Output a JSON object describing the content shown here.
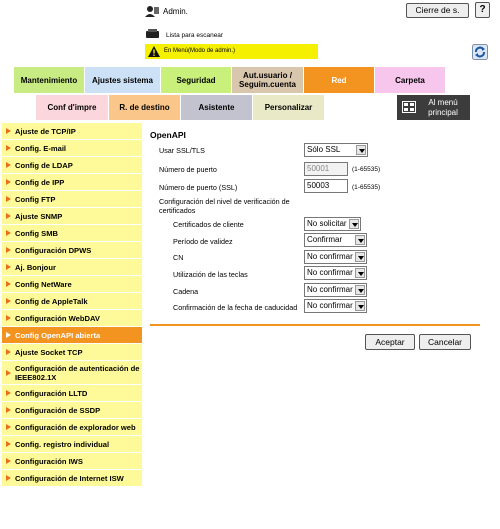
{
  "header": {
    "user_label": "Admin.",
    "logout_label": "Cierre de s.",
    "help_label": "?",
    "scan_list_label": "Lista para escanear",
    "mode_label": "En Menú(Modo de admin.)"
  },
  "tabs_top": [
    {
      "label": "Mantenimiento",
      "color": "#c9eb84"
    },
    {
      "label": "Ajustes sistema",
      "color": "#cce1f5"
    },
    {
      "label": "Seguridad",
      "color": "#c8f07a"
    },
    {
      "label": "Aut.usuario / Seguim.cuenta",
      "color": "#d9c7ad"
    },
    {
      "label": "Red",
      "color": "#f39320"
    },
    {
      "label": "Carpeta",
      "color": "#f7c6ec"
    }
  ],
  "tabs_bottom": [
    {
      "label": "Conf d'impre",
      "color": "#fbd6dd"
    },
    {
      "label": "R. de destino",
      "color": "#fbc68a"
    },
    {
      "label": "Asistente",
      "color": "#c3c3cf"
    },
    {
      "label": "Personalizar",
      "color": "#e9e9c7"
    }
  ],
  "menu_button": {
    "label": "Al menú principal"
  },
  "sidebar": {
    "items": [
      {
        "label": "Ajuste de TCP/IP"
      },
      {
        "label": "Config. E-mail"
      },
      {
        "label": "Config de LDAP"
      },
      {
        "label": "Config de IPP"
      },
      {
        "label": "Config FTP"
      },
      {
        "label": "Ajuste SNMP"
      },
      {
        "label": "Config SMB"
      },
      {
        "label": "Configuración DPWS"
      },
      {
        "label": "Aj. Bonjour"
      },
      {
        "label": "Config NetWare"
      },
      {
        "label": "Config de AppleTalk"
      },
      {
        "label": "Configuración WebDAV"
      },
      {
        "label": "Config OpenAPI abierta"
      },
      {
        "label": "Ajuste Socket TCP"
      },
      {
        "label": "Configuración de autenticación de IEEE802.1X"
      },
      {
        "label": "Configuración LLTD"
      },
      {
        "label": "Configuración de SSDP"
      },
      {
        "label": "Configuración de explorador web"
      },
      {
        "label": "Config. registro individual"
      },
      {
        "label": "Configuración IWS"
      },
      {
        "label": "Configuración de Internet ISW"
      }
    ]
  },
  "main": {
    "title": "OpenAPI",
    "use_ssl": {
      "label": "Usar SSL/TLS",
      "value": "Sólo SSL"
    },
    "port": {
      "label": "Número de puerto",
      "value": "50001",
      "range": "(1-65535)"
    },
    "port_ssl": {
      "label": "Número de puerto (SSL)",
      "value": "50003",
      "range": "(1-65535)"
    },
    "verify_heading": "Configuración del nivel de verificación de certificados",
    "verify": [
      {
        "label": "Certificados de cliente",
        "value": "No solicitar"
      },
      {
        "label": "Período de validez",
        "value": "Confirmar"
      },
      {
        "label": "CN",
        "value": "No confirmar"
      },
      {
        "label": "Utilización de las teclas",
        "value": "No confirmar"
      },
      {
        "label": "Cadena",
        "value": "No confirmar"
      },
      {
        "label": "Confirmación de la fecha de caducidad",
        "value": "No confirmar"
      }
    ],
    "ok_label": "Aceptar",
    "cancel_label": "Cancelar"
  }
}
